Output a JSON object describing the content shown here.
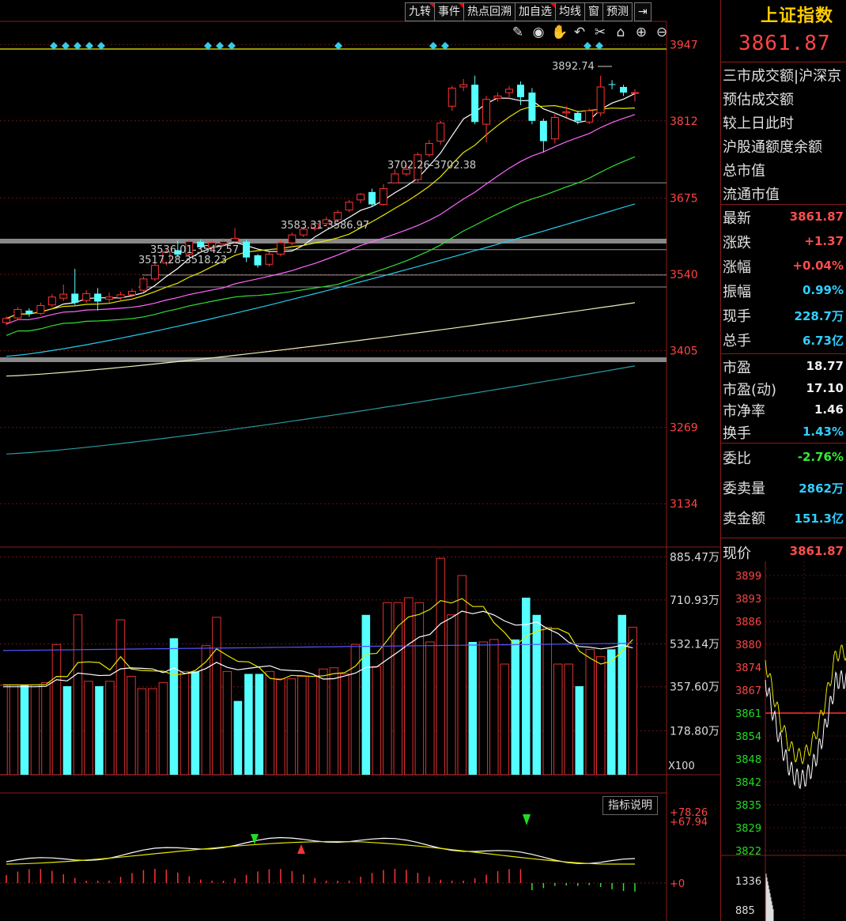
{
  "toolbar": {
    "buttons": [
      "九转",
      "事件",
      "热点回溯",
      "加自选",
      "均线",
      "窗",
      "预测"
    ],
    "flagged": [
      true,
      true,
      false,
      true,
      false,
      false,
      false
    ]
  },
  "icons": [
    "pen-icon",
    "eye-icon",
    "hand-icon",
    "undo-icon",
    "scissors-icon",
    "lock-icon",
    "zoom-in-icon",
    "zoom-out-icon"
  ],
  "main_axis": {
    "labels": [
      "3947",
      "3812",
      "3675",
      "3540",
      "3405",
      "3269",
      "3134"
    ]
  },
  "annotations": {
    "high": "3892.74",
    "gap1": "3702.26-3702.38",
    "gap2": "3583.31-3586.97",
    "gap3": "3536.01-3542.57",
    "gap4": "3517.28-3518.23"
  },
  "volume_axis": {
    "labels": [
      "885.47万",
      "710.93万",
      "532.14万",
      "357.60万",
      "178.80万"
    ],
    "unit": "X100"
  },
  "macd_axis": {
    "labels": [
      "+78.26",
      "+67.94",
      "+0"
    ],
    "help": "指标说明"
  },
  "panel": {
    "title": "上证指数",
    "price": "3861.87",
    "info_rows": [
      "三市成交额|沪深京",
      "预估成交额",
      "较上日此时",
      "沪股通额度余额",
      "总市值",
      "流通市值"
    ],
    "quote": [
      {
        "label": "最新",
        "value": "3861.87",
        "color": "red"
      },
      {
        "label": "涨跌",
        "value": "+1.37",
        "color": "red"
      },
      {
        "label": "涨幅",
        "value": "+0.04%",
        "color": "red"
      },
      {
        "label": "振幅",
        "value": "0.99%",
        "color": "cyan"
      },
      {
        "label": "现手",
        "value": "228.7万",
        "color": "cyan"
      },
      {
        "label": "总手",
        "value": "6.73亿",
        "color": "cyan"
      }
    ],
    "valuation": [
      {
        "label": "市盈",
        "value": "18.77",
        "color": "white"
      },
      {
        "label": "市盈(动)",
        "value": "17.10",
        "color": "white"
      },
      {
        "label": "市净率",
        "value": "1.46",
        "color": "white"
      },
      {
        "label": "换手",
        "value": "1.43%",
        "color": "cyan"
      }
    ],
    "orders": [
      {
        "label": "委比",
        "value": "-2.76%",
        "color": "green"
      },
      {
        "label": "委卖量",
        "value": "2862万",
        "color": "cyan"
      },
      {
        "label": "卖金额",
        "value": "151.3亿",
        "color": "cyan"
      }
    ],
    "current_label": "现价",
    "current_value": "3861.87",
    "mini_axis": [
      "3899",
      "3893",
      "3886",
      "3880",
      "3874",
      "3867",
      "3861",
      "3854",
      "3848",
      "3842",
      "3835",
      "3829",
      "3822"
    ],
    "mini_vol_axis": [
      "1336",
      "885"
    ]
  },
  "chart_data": {
    "type": "candlestick",
    "candles": [
      {
        "o": 3455,
        "c": 3462,
        "h": 3466,
        "l": 3450
      },
      {
        "o": 3463,
        "c": 3478,
        "h": 3482,
        "l": 3460
      },
      {
        "o": 3476,
        "c": 3470,
        "h": 3480,
        "l": 3465
      },
      {
        "o": 3471,
        "c": 3485,
        "h": 3490,
        "l": 3468
      },
      {
        "o": 3486,
        "c": 3500,
        "h": 3505,
        "l": 3482
      },
      {
        "o": 3498,
        "c": 3505,
        "h": 3522,
        "l": 3493
      },
      {
        "o": 3506,
        "c": 3490,
        "h": 3550,
        "l": 3486
      },
      {
        "o": 3494,
        "c": 3506,
        "h": 3512,
        "l": 3490
      },
      {
        "o": 3506,
        "c": 3492,
        "h": 3516,
        "l": 3476
      },
      {
        "o": 3496,
        "c": 3500,
        "h": 3508,
        "l": 3490
      },
      {
        "o": 3499,
        "c": 3504,
        "h": 3509,
        "l": 3495
      },
      {
        "o": 3504,
        "c": 3510,
        "h": 3515,
        "l": 3500
      },
      {
        "o": 3512,
        "c": 3532,
        "h": 3536,
        "l": 3508
      },
      {
        "o": 3532,
        "c": 3556,
        "h": 3560,
        "l": 3528
      },
      {
        "o": 3560,
        "c": 3580,
        "h": 3584,
        "l": 3556
      },
      {
        "o": 3583,
        "c": 3575,
        "h": 3600,
        "l": 3570
      },
      {
        "o": 3576,
        "c": 3598,
        "h": 3602,
        "l": 3572
      },
      {
        "o": 3598,
        "c": 3588,
        "h": 3602,
        "l": 3585
      },
      {
        "o": 3588,
        "c": 3596,
        "h": 3600,
        "l": 3584
      },
      {
        "o": 3594,
        "c": 3598,
        "h": 3604,
        "l": 3590
      },
      {
        "o": 3598,
        "c": 3604,
        "h": 3622,
        "l": 3594
      },
      {
        "o": 3598,
        "c": 3570,
        "h": 3602,
        "l": 3562
      },
      {
        "o": 3574,
        "c": 3556,
        "h": 3576,
        "l": 3552
      },
      {
        "o": 3558,
        "c": 3576,
        "h": 3580,
        "l": 3554
      },
      {
        "o": 3576,
        "c": 3596,
        "h": 3600,
        "l": 3572
      },
      {
        "o": 3596,
        "c": 3610,
        "h": 3614,
        "l": 3592
      },
      {
        "o": 3610,
        "c": 3620,
        "h": 3624,
        "l": 3606
      },
      {
        "o": 3621,
        "c": 3630,
        "h": 3634,
        "l": 3617
      },
      {
        "o": 3630,
        "c": 3637,
        "h": 3642,
        "l": 3626
      },
      {
        "o": 3637,
        "c": 3650,
        "h": 3654,
        "l": 3633
      },
      {
        "o": 3654,
        "c": 3668,
        "h": 3672,
        "l": 3650
      },
      {
        "o": 3672,
        "c": 3682,
        "h": 3684,
        "l": 3666
      },
      {
        "o": 3686,
        "c": 3664,
        "h": 3692,
        "l": 3660
      },
      {
        "o": 3664,
        "c": 3692,
        "h": 3700,
        "l": 3662
      },
      {
        "o": 3702,
        "c": 3718,
        "h": 3726,
        "l": 3702
      },
      {
        "o": 3718,
        "c": 3726,
        "h": 3736,
        "l": 3714
      },
      {
        "o": 3708,
        "c": 3752,
        "h": 3756,
        "l": 3704
      },
      {
        "o": 3752,
        "c": 3772,
        "h": 3778,
        "l": 3748
      },
      {
        "o": 3776,
        "c": 3808,
        "h": 3812,
        "l": 3770
      },
      {
        "o": 3838,
        "c": 3870,
        "h": 3874,
        "l": 3830
      },
      {
        "o": 3872,
        "c": 3876,
        "h": 3886,
        "l": 3865
      },
      {
        "o": 3876,
        "c": 3810,
        "h": 3892,
        "l": 3806
      },
      {
        "o": 3806,
        "c": 3850,
        "h": 3856,
        "l": 3774
      },
      {
        "o": 3852,
        "c": 3856,
        "h": 3862,
        "l": 3846
      },
      {
        "o": 3862,
        "c": 3868,
        "h": 3874,
        "l": 3850
      },
      {
        "o": 3876,
        "c": 3854,
        "h": 3882,
        "l": 3840
      },
      {
        "o": 3862,
        "c": 3812,
        "h": 3870,
        "l": 3806
      },
      {
        "o": 3812,
        "c": 3776,
        "h": 3816,
        "l": 3756
      },
      {
        "o": 3780,
        "c": 3818,
        "h": 3826,
        "l": 3772
      },
      {
        "o": 3826,
        "c": 3828,
        "h": 3838,
        "l": 3818
      },
      {
        "o": 3826,
        "c": 3812,
        "h": 3830,
        "l": 3806
      },
      {
        "o": 3810,
        "c": 3830,
        "h": 3834,
        "l": 3806
      },
      {
        "o": 3826,
        "c": 3872,
        "h": 3892,
        "l": 3820
      },
      {
        "o": 3877,
        "c": 3876,
        "h": 3884,
        "l": 3868
      },
      {
        "o": 3872,
        "c": 3862,
        "h": 3876,
        "l": 3856
      },
      {
        "o": 3862,
        "c": 3862,
        "h": 3868,
        "l": 3846
      }
    ],
    "volumes": [
      365,
      365,
      365,
      365,
      375,
      530,
      360,
      650,
      380,
      360,
      380,
      630,
      400,
      350,
      350,
      375,
      555,
      420,
      420,
      525,
      640,
      420,
      300,
      410,
      410,
      420,
      390,
      390,
      400,
      400,
      430,
      435,
      410,
      530,
      650,
      440,
      700,
      700,
      720,
      700,
      540,
      880,
      650,
      810,
      540,
      540,
      550,
      450,
      550,
      720,
      650,
      600,
      450,
      450,
      360,
      510,
      480,
      510,
      650,
      600
    ],
    "volume_colors": [],
    "ylim": [
      3060,
      3970
    ],
    "volume_ylim": [
      0,
      900
    ]
  }
}
